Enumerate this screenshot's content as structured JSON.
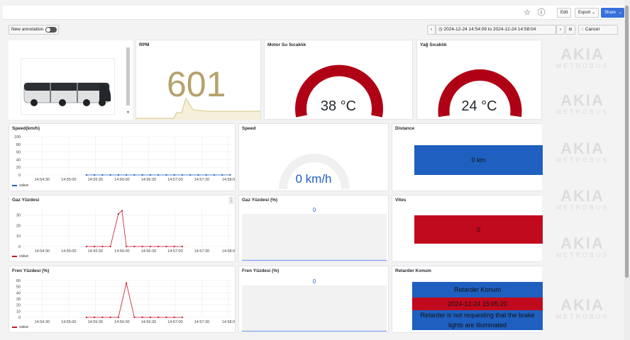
{
  "toolbar": {
    "edit_label": "Edit",
    "export_label": "Export ⌄",
    "share_label": "Share"
  },
  "controls": {
    "annotation_label": "New annotation",
    "time_range": "2024-12-24 14:54:09 to 2024-12-24 14:58:04",
    "cancel_label": "Cancel"
  },
  "watermark": {
    "line1": "AKIA",
    "line2": "METROBUS"
  },
  "panels": {
    "rpm": {
      "title": "RPM",
      "value": "601"
    },
    "coolant": {
      "title": "Motor Su Sıcaklık",
      "value": "38 °C",
      "level": 0.38
    },
    "oil": {
      "title": "Yağ Sıcaklık",
      "value": "24 °C",
      "level": 0.24
    },
    "speed_chart": {
      "title": "Speed(km/h)",
      "legend": "value"
    },
    "speed_gauge": {
      "title": "Speed",
      "value": "0 km/h",
      "level": 0
    },
    "distance": {
      "title": "Distance",
      "value": "0 km"
    },
    "gas_chart": {
      "title": "Gaz Yüzdesi",
      "legend": "value"
    },
    "gas_pct": {
      "title": "Gaz Yüzdesi (%)",
      "value": "0"
    },
    "gear": {
      "title": "Vites",
      "value": "0"
    },
    "brake_chart": {
      "title": "Fren Yüzdesi (%)",
      "legend": "value"
    },
    "brake_pct": {
      "title": "Fren Yüzdesi (%)",
      "value": "0"
    },
    "retarder": {
      "title": "Retarder Konum",
      "header": "Retarder Konum",
      "timestamp": "2024-12-24 15:05:20",
      "message_line1": "Retarder is not requesting that the brake",
      "message_line2": "lights are illuminated"
    }
  },
  "colors": {
    "blue_stat": "#1f5fbf",
    "red_stat": "#c20a1e",
    "gauge_red": "#b00015",
    "gold": "#b5a26c",
    "series_blue": "#1f60c4",
    "series_red": "#c4162a"
  },
  "chart_data": [
    {
      "type": "line",
      "title": "Speed(km/h)",
      "x": [
        "14:55:20",
        "14:55:29",
        "14:55:38",
        "14:55:47",
        "14:55:56",
        "14:56:05",
        "14:56:14",
        "14:56:23",
        "14:56:32",
        "14:56:41",
        "14:56:50",
        "14:56:59",
        "14:57:08",
        "14:57:17",
        "14:57:26",
        "14:57:35",
        "14:57:44",
        "14:57:53",
        "14:58:02"
      ],
      "series": [
        {
          "name": "value",
          "values": [
            0,
            0,
            0,
            0,
            0,
            0,
            0,
            0,
            0,
            0,
            0,
            0,
            0,
            0,
            0,
            0,
            0,
            0,
            0
          ]
        }
      ],
      "xticks": [
        "14:54:30",
        "14:55:00",
        "14:55:30",
        "14:56:00",
        "14:56:30",
        "14:57:00",
        "14:57:30",
        "14:58:0"
      ],
      "yticks": [
        0,
        20,
        40,
        60,
        80,
        100
      ],
      "ylim": [
        0,
        100
      ],
      "xlim": [
        "14:54:09",
        "14:58:04"
      ]
    },
    {
      "type": "line",
      "title": "Gaz Yüzdesi",
      "x": [
        "14:55:20",
        "14:55:29",
        "14:55:38",
        "14:55:47",
        "14:55:56",
        "14:56:00",
        "14:56:05",
        "14:56:14",
        "14:56:23",
        "14:56:32",
        "14:56:41",
        "14:56:50",
        "14:56:59",
        "14:57:08"
      ],
      "series": [
        {
          "name": "value",
          "values": [
            0,
            0,
            0,
            0,
            31,
            34,
            0,
            0,
            0,
            0,
            0,
            0,
            0,
            0
          ]
        }
      ],
      "xticks": [
        "14:54:30",
        "14:55:00",
        "14:55:30",
        "14:56:00",
        "14:56:30",
        "14:57:00",
        "14:57:30",
        "14:58:0"
      ],
      "yticks": [
        0,
        10,
        20,
        30
      ],
      "ylim": [
        0,
        35
      ],
      "xlim": [
        "14:54:09",
        "14:58:04"
      ]
    },
    {
      "type": "line",
      "title": "Fren Yüzdesi (%)",
      "x": [
        "14:55:20",
        "14:55:29",
        "14:55:38",
        "14:55:47",
        "14:55:56",
        "14:56:05",
        "14:56:14",
        "14:56:23",
        "14:56:32",
        "14:56:41",
        "14:56:50",
        "14:56:59",
        "14:57:08"
      ],
      "series": [
        {
          "name": "value",
          "values": [
            0,
            0,
            0,
            0,
            0,
            56,
            0,
            0,
            0,
            0,
            0,
            0,
            0
          ]
        }
      ],
      "xticks": [
        "14:54:30",
        "14:55:00",
        "14:55:30",
        "14:56:00",
        "14:56:30",
        "14:57:00",
        "14:57:30",
        "14:58:0"
      ],
      "yticks": [
        0,
        10,
        20,
        30,
        40,
        50,
        60
      ],
      "ylim": [
        0,
        60
      ],
      "xlim": [
        "14:54:09",
        "14:58:04"
      ]
    }
  ]
}
